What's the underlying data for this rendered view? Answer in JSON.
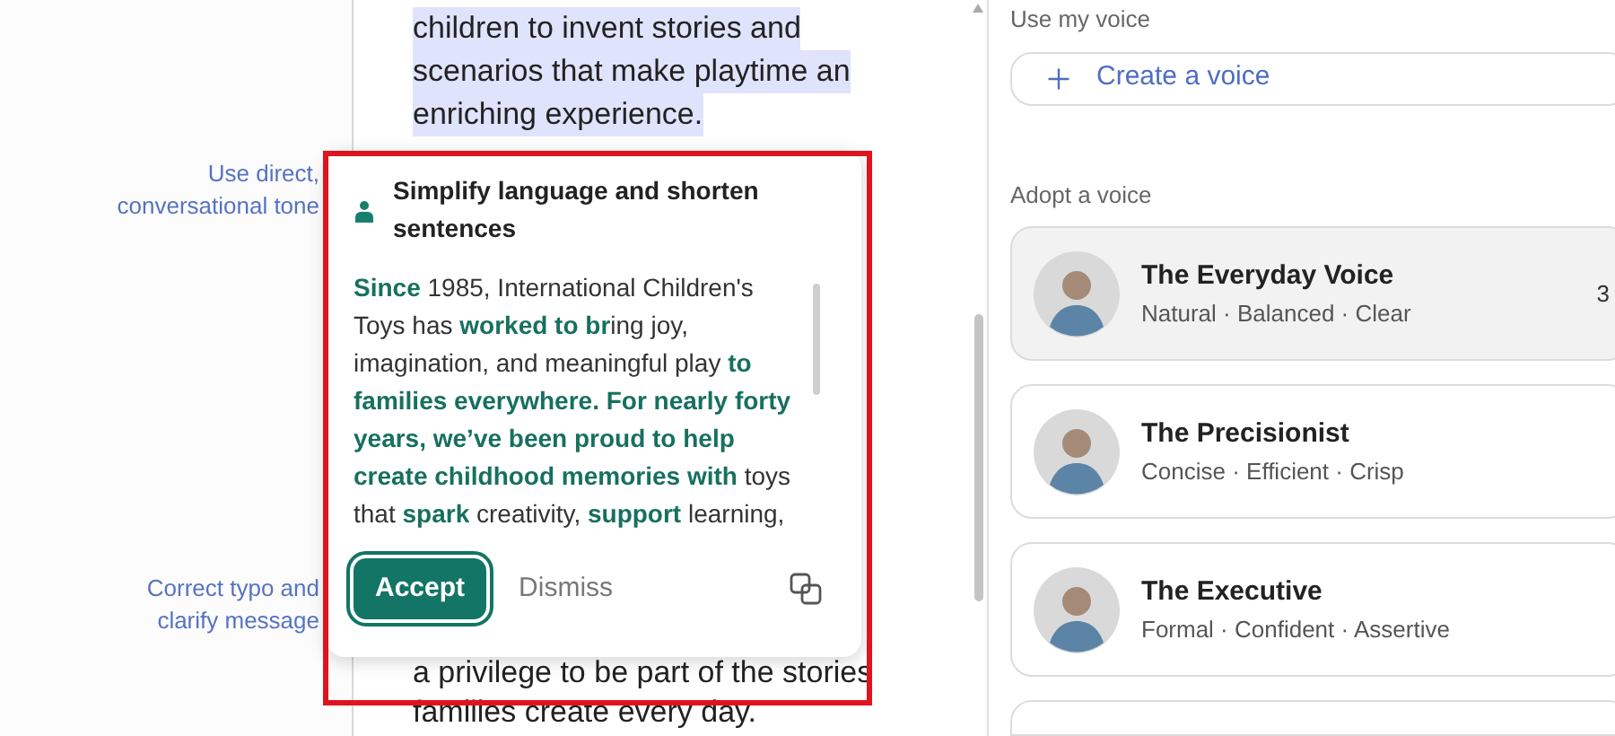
{
  "margin_comments": [
    {
      "text": "Use direct, conversational tone"
    },
    {
      "text": "Correct typo and clarify message"
    }
  ],
  "document": {
    "lines_above": [
      "children to invent stories and",
      "scenarios that make playtime an",
      "enriching experience."
    ],
    "above_selected": true,
    "lines_below": [
      "a privilege to be part of the stories",
      "families create every day."
    ]
  },
  "suggestion": {
    "title": "Simplify language and shorten sentences",
    "text": "**Since** 1985, International Children's Toys has **worked to br**ing joy, imagination, and meaningful play **to families everywhere. For nearly forty years, we’ve been proud to help create childhood memories with** toys that **spark** creativity, **support** learning,",
    "accept": "Accept",
    "dismiss": "Dismiss"
  },
  "annotation": {
    "color": "#e0141e"
  },
  "voice_panel": {
    "my_voice_label": "Use my voice",
    "create_voice": "Create a voice",
    "adopt_label": "Adopt a voice",
    "voices": [
      {
        "name": "The Everyday Voice",
        "traits": "Natural · Balanced · Clear",
        "badge": "3",
        "selected": true
      },
      {
        "name": "The Precisionist",
        "traits": "Concise · Efficient · Crisp",
        "selected": false
      },
      {
        "name": "The Executive",
        "traits": "Formal · Confident · Assertive",
        "selected": false
      }
    ]
  }
}
